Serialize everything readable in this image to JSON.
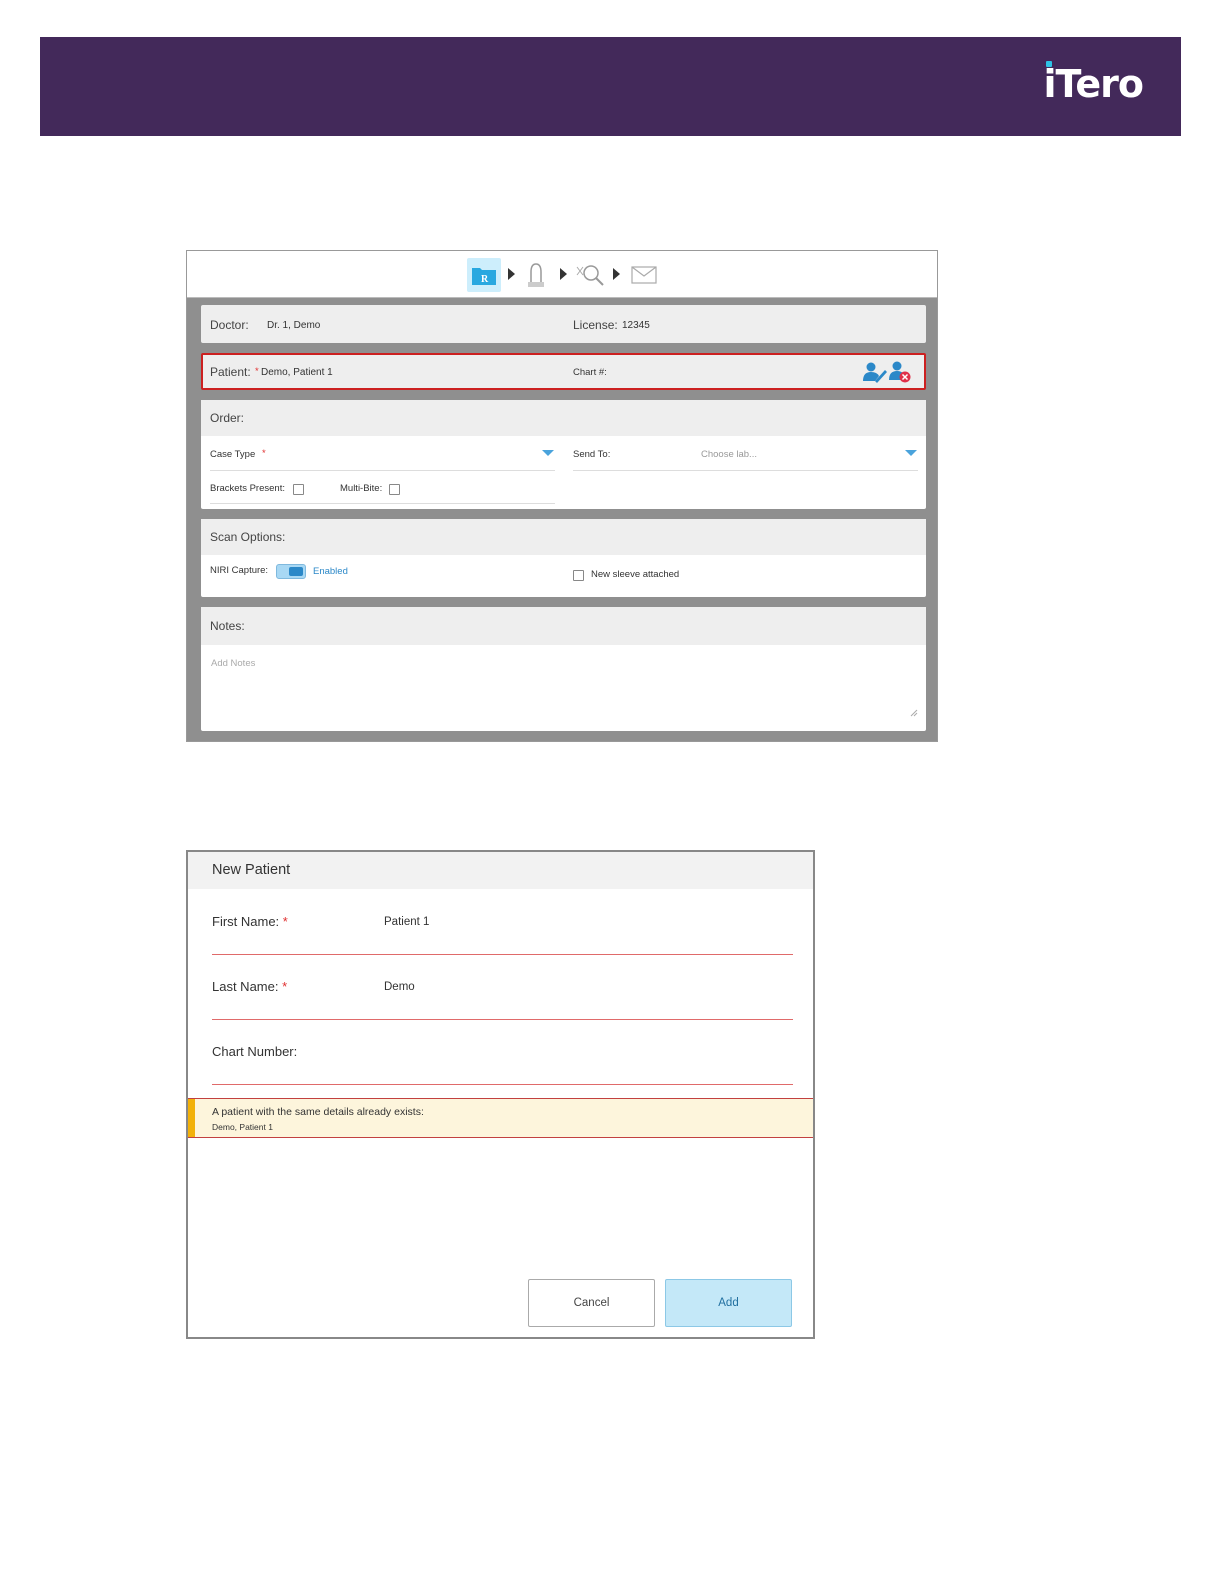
{
  "brand": {
    "logo_text": "iTero",
    "banner_color": "#43295a",
    "accent_dot": "#2ec4e6"
  },
  "workflow": {
    "steps": [
      {
        "icon": "rx-folder-icon",
        "active": true
      },
      {
        "icon": "scan-tooth-icon",
        "active": false
      },
      {
        "icon": "view-search-icon",
        "active": false
      },
      {
        "icon": "send-envelope-icon",
        "active": false
      }
    ]
  },
  "rx": {
    "doctor_label": "Doctor:",
    "doctor_value": "Dr. 1, Demo",
    "license_label": "License:",
    "license_value": "12345",
    "patient_label": "Patient:",
    "patient_required": "*",
    "patient_value": "Demo, Patient 1",
    "chart_label": "Chart #:",
    "order_title": "Order:",
    "case_type_label": "Case Type",
    "case_type_required": "*",
    "send_to_label": "Send To:",
    "send_to_placeholder": "Choose lab...",
    "brackets_label": "Brackets Present:",
    "multibite_label": "Multi-Bite:",
    "scan_options_title": "Scan Options:",
    "niri_label": "NIRI Capture:",
    "niri_state": "Enabled",
    "sleeve_label": "New sleeve attached",
    "notes_title": "Notes:",
    "notes_placeholder": "Add Notes"
  },
  "dialog": {
    "title": "New Patient",
    "first_name_label": "First Name:",
    "first_name_value": "Patient 1",
    "last_name_label": "Last Name:",
    "last_name_value": "Demo",
    "required_mark": "*",
    "chart_number_label": "Chart Number:",
    "warning_title": "A patient with the same details already exists:",
    "warning_detail": "Demo, Patient 1",
    "cancel_label": "Cancel",
    "add_label": "Add"
  }
}
